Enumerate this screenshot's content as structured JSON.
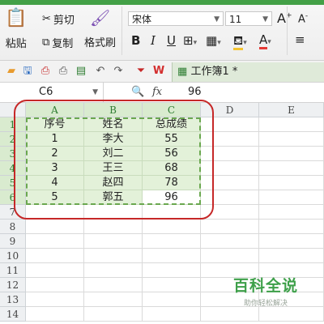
{
  "ribbon": {
    "cut_label": "剪切",
    "paste_label": "粘贴",
    "copy_label": "复制",
    "format_painter_label": "格式刷",
    "font_name": "宋体",
    "font_size": "11",
    "bold": "B",
    "italic": "I",
    "underline": "U",
    "font_color_letter": "A",
    "grow_font": "A",
    "shrink_font": "A"
  },
  "tab": {
    "title": "工作簿1 *"
  },
  "formula_bar": {
    "cell_ref": "C6",
    "fx": "fx",
    "value": "96"
  },
  "columns": [
    "A",
    "B",
    "C",
    "D",
    "E"
  ],
  "rows": [
    "1",
    "2",
    "3",
    "4",
    "5",
    "6",
    "7",
    "8",
    "9",
    "10",
    "11",
    "12",
    "13",
    "14"
  ],
  "table": {
    "headers": [
      "序号",
      "姓名",
      "总成绩"
    ],
    "rows": [
      [
        "1",
        "李大",
        "55"
      ],
      [
        "2",
        "刘二",
        "56"
      ],
      [
        "3",
        "王三",
        "68"
      ],
      [
        "4",
        "赵四",
        "78"
      ],
      [
        "5",
        "郭五",
        "96"
      ]
    ]
  },
  "watermark": {
    "title": "百科全说",
    "subtitle": "助你轻松解决"
  },
  "colors": {
    "accent": "#43a047",
    "selection_fill": "#e3f1d9",
    "annotation": "#c62828"
  }
}
